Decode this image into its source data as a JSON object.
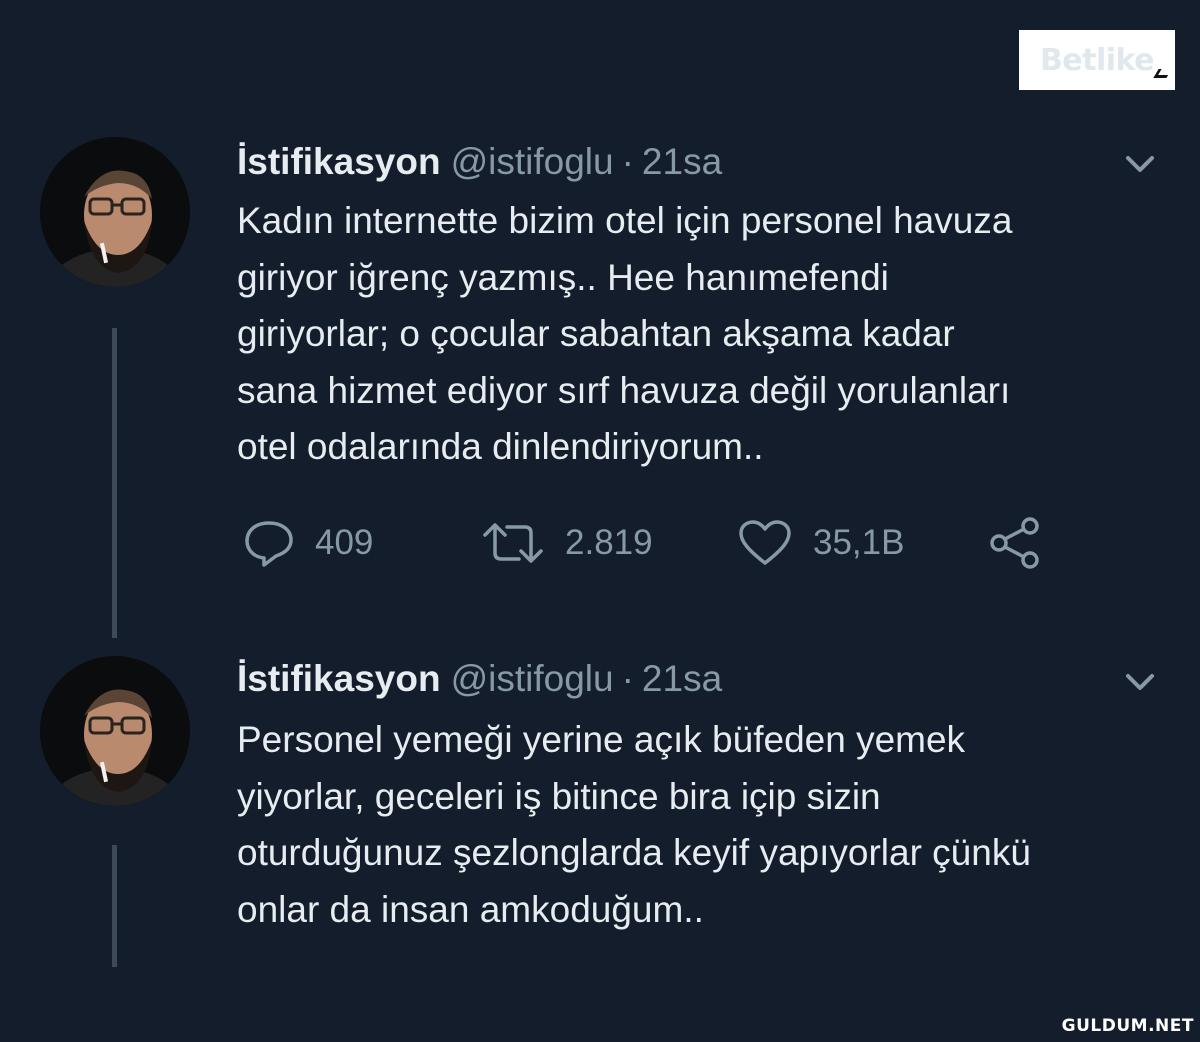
{
  "watermark_top": "Betlike",
  "watermark_bottom": "GULDUM.NET",
  "tweets": [
    {
      "display_name": "İstifikasyon",
      "handle": "@istifoglu",
      "separator": "·",
      "time": "21sa",
      "lines": [
        "Kadın internette bizim otel için personel havuza",
        "giriyor iğrenç yazmış.. Hee hanımefendi",
        "giriyorlar; o çocular sabahtan akşama kadar",
        "sana hizmet ediyor sırf havuza değil yorulanları",
        "otel odalarında dinlendiriyorum.."
      ],
      "actions": {
        "replies": "409",
        "retweets": "2.819",
        "likes": "35,1B"
      }
    },
    {
      "display_name": "İstifikasyon",
      "handle": "@istifoglu",
      "separator": "·",
      "time": "21sa",
      "lines": [
        "Personel yemeği yerine açık büfeden yemek",
        "yiyorlar, geceleri iş bitince bira içip sizin",
        "oturduğunuz şezlonglarda keyif yapıyorlar çünkü",
        "onlar da insan amkoduğum.."
      ]
    }
  ],
  "colors": {
    "background": "#141d2b",
    "text": "#e6ecf0",
    "secondary": "#8899a6",
    "thread_line": "#3e4a59",
    "watermark_brand": "#e8275f"
  },
  "icons": {
    "reply": "reply-icon",
    "retweet": "retweet-icon",
    "like": "heart-icon",
    "share": "share-icon",
    "menu": "chevron-down-icon"
  }
}
